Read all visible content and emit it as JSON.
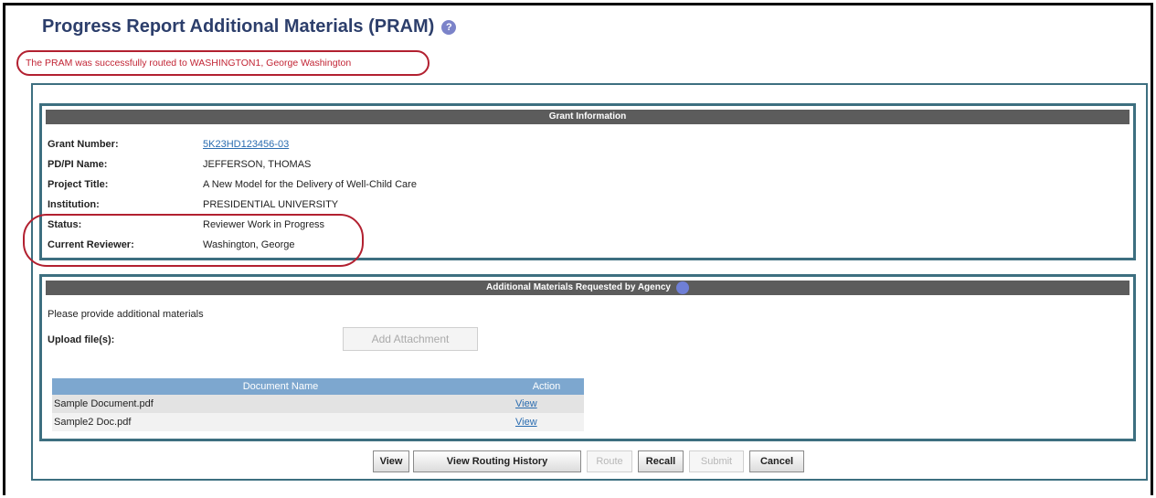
{
  "page": {
    "title": "Progress Report Additional Materials (PRAM)",
    "help_icon": "question-circle-icon",
    "success_message": "The PRAM was successfully routed to WASHINGTON1, George Washington"
  },
  "grant_info": {
    "header": "Grant Information",
    "fields": [
      {
        "label": "Grant Number:",
        "value": "5K23HD123456-03"
      },
      {
        "label": "PD/PI Name:",
        "value": "JEFFERSON, THOMAS"
      },
      {
        "label": "Project Title:",
        "value": "A New Model for the Delivery of Well-Child Care"
      },
      {
        "label": "Institution:",
        "value": "PRESIDENTIAL UNIVERSITY"
      },
      {
        "label": "Status:",
        "value": "Reviewer Work in Progress"
      },
      {
        "label": "Current Reviewer:",
        "value": "Washington, George"
      }
    ]
  },
  "materials": {
    "header": "Additional Materials Requested by Agency",
    "instructions": "Please provide additional materials",
    "upload_label": "Upload file(s):",
    "add_attachment": "Add Attachment",
    "table": {
      "columns": [
        "Document Name",
        "Action"
      ],
      "rows": [
        {
          "name": "Sample Document.pdf",
          "action": "View"
        },
        {
          "name": "Sample2 Doc.pdf",
          "action": "View"
        }
      ]
    }
  },
  "buttons": {
    "view": "View",
    "routing_history": "View Routing History",
    "route": "Route",
    "recall": "Recall",
    "submit": "Submit",
    "cancel": "Cancel"
  },
  "colors": {
    "title": "#2c3e6b",
    "highlight_ellipse": "#b22030",
    "panel_border": "#3d6f80",
    "section_header": "#5c5c5c",
    "table_header": "#7da7cf",
    "link": "#2a6cb0"
  }
}
